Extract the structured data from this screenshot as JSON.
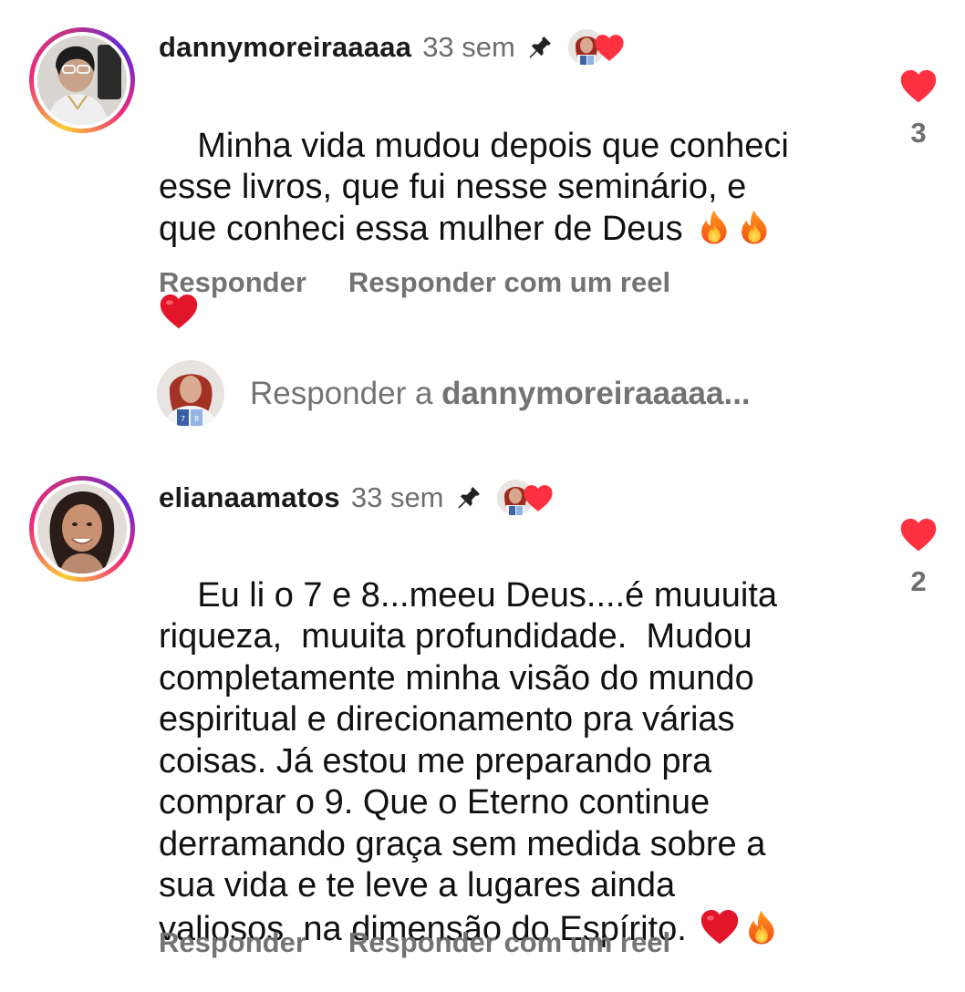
{
  "comments": [
    {
      "username": "dannymoreiraaaaa",
      "time": "33 sem",
      "text": "Minha vida mudou depois que conheci\nesse livros, que fui nesse seminário, e\nque conheci essa mulher de Deus ",
      "likes": "3",
      "actions": {
        "reply": "Responder",
        "reply_reel": "Responder com um reel"
      },
      "emojis": [
        "fire",
        "fire",
        "red-heart"
      ]
    },
    {
      "username": "elianaamatos",
      "time": "33 sem",
      "text": "Eu li o 7 e 8...meeu Deus....é muuuita\nriqueza,  muuita profundidade.  Mudou\ncompletamente minha visão do mundo\nespiritual e direcionamento pra várias\ncoisas. Já estou me preparando pra\ncomprar o 9. Que o Eterno continue\nderramando graça sem medida sobre a\nsua vida e te leve a lugares ainda\nvaliosos  na dimensão do Espírito. ",
      "likes": "2",
      "actions": {
        "reply": "Responder",
        "reply_reel": "Responder com um reel"
      },
      "emojis": [
        "red-heart",
        "fire"
      ]
    }
  ],
  "reply_input": {
    "prefix": "Responder a ",
    "target": "dannymoreiraaaaa..."
  },
  "colors": {
    "like_red": "#ff3040",
    "muted": "#737373"
  }
}
